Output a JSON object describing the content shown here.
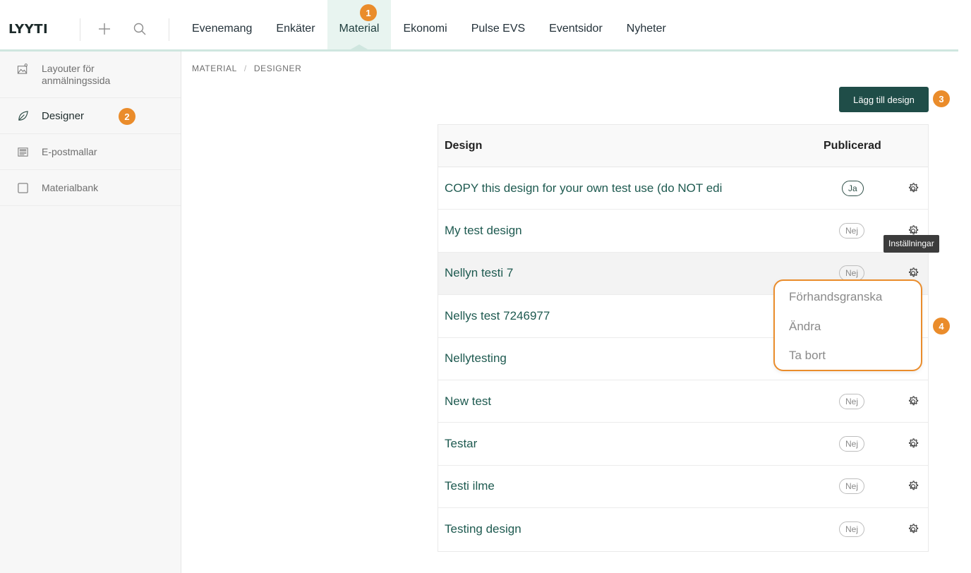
{
  "app": {
    "logo": "LYYTI"
  },
  "nav": [
    {
      "label": "Evenemang"
    },
    {
      "label": "Enkäter"
    },
    {
      "label": "Material"
    },
    {
      "label": "Ekonomi"
    },
    {
      "label": "Pulse EVS"
    },
    {
      "label": "Eventsidor"
    },
    {
      "label": "Nyheter"
    }
  ],
  "nav_active": "Material",
  "sidebar": {
    "items": [
      {
        "label": "Layouter för anmälningssida",
        "icon": "landscape-image-icon"
      },
      {
        "label": "Designer",
        "icon": "leaf-icon"
      },
      {
        "label": "E-postmallar",
        "icon": "email-template-icon"
      },
      {
        "label": "Materialbank",
        "icon": "square-icon"
      }
    ]
  },
  "breadcrumb": {
    "root": "MATERIAL",
    "sep": "/",
    "current": "DESIGNER"
  },
  "toolbar": {
    "add_label": "Lägg till design"
  },
  "table": {
    "col_design": "Design",
    "col_published": "Publicerad",
    "rows": [
      {
        "name": "COPY this design for your own test use (do NOT edi",
        "published": "Ja"
      },
      {
        "name": "My test design",
        "published": "Nej"
      },
      {
        "name": "Nellyn testi 7",
        "published": "Nej"
      },
      {
        "name": "Nellys test 7246977",
        "published": ""
      },
      {
        "name": "Nellytesting",
        "published": ""
      },
      {
        "name": "New test",
        "published": "Nej"
      },
      {
        "name": "Testar",
        "published": "Nej"
      },
      {
        "name": "Testi ilme",
        "published": "Nej"
      },
      {
        "name": "Testing design",
        "published": "Nej"
      }
    ]
  },
  "tooltip": "Inställningar",
  "dropdown": {
    "items": [
      "Förhandsgranska",
      "Ändra",
      "Ta bort"
    ]
  },
  "badges": [
    "1",
    "2",
    "3",
    "4"
  ],
  "colors": {
    "accent": "#1f4d48",
    "badge": "#ea8c2b",
    "link": "#1e5a50",
    "active_nav_bg": "#e8f4f0"
  }
}
